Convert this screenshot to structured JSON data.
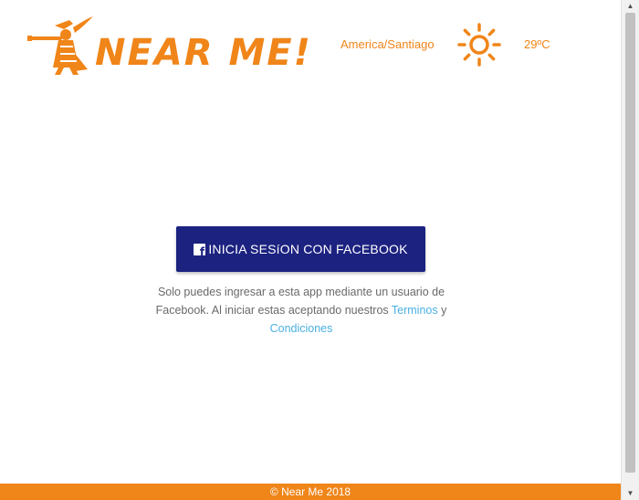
{
  "header": {
    "logo_text": "NEAR ME!",
    "location": "America/Santiago",
    "weather_icon": "sun-icon",
    "temperature": "29ºC"
  },
  "main": {
    "login_button_label": "INICIA SESíON CON FACEBOOK",
    "disclaimer_text": "Solo puedes ingresar a esta app mediante un usuario de Facebook. Al iniciar estas aceptando nuestros",
    "terms_link": "Terminos",
    "conjunction": "y",
    "conditions_link": "Condiciones"
  },
  "footer": {
    "copyright": "© Near Me 2018"
  },
  "colors": {
    "brand_orange": "#f08519",
    "facebook_blue": "#1c2280",
    "link_blue": "#4ab0e3"
  }
}
